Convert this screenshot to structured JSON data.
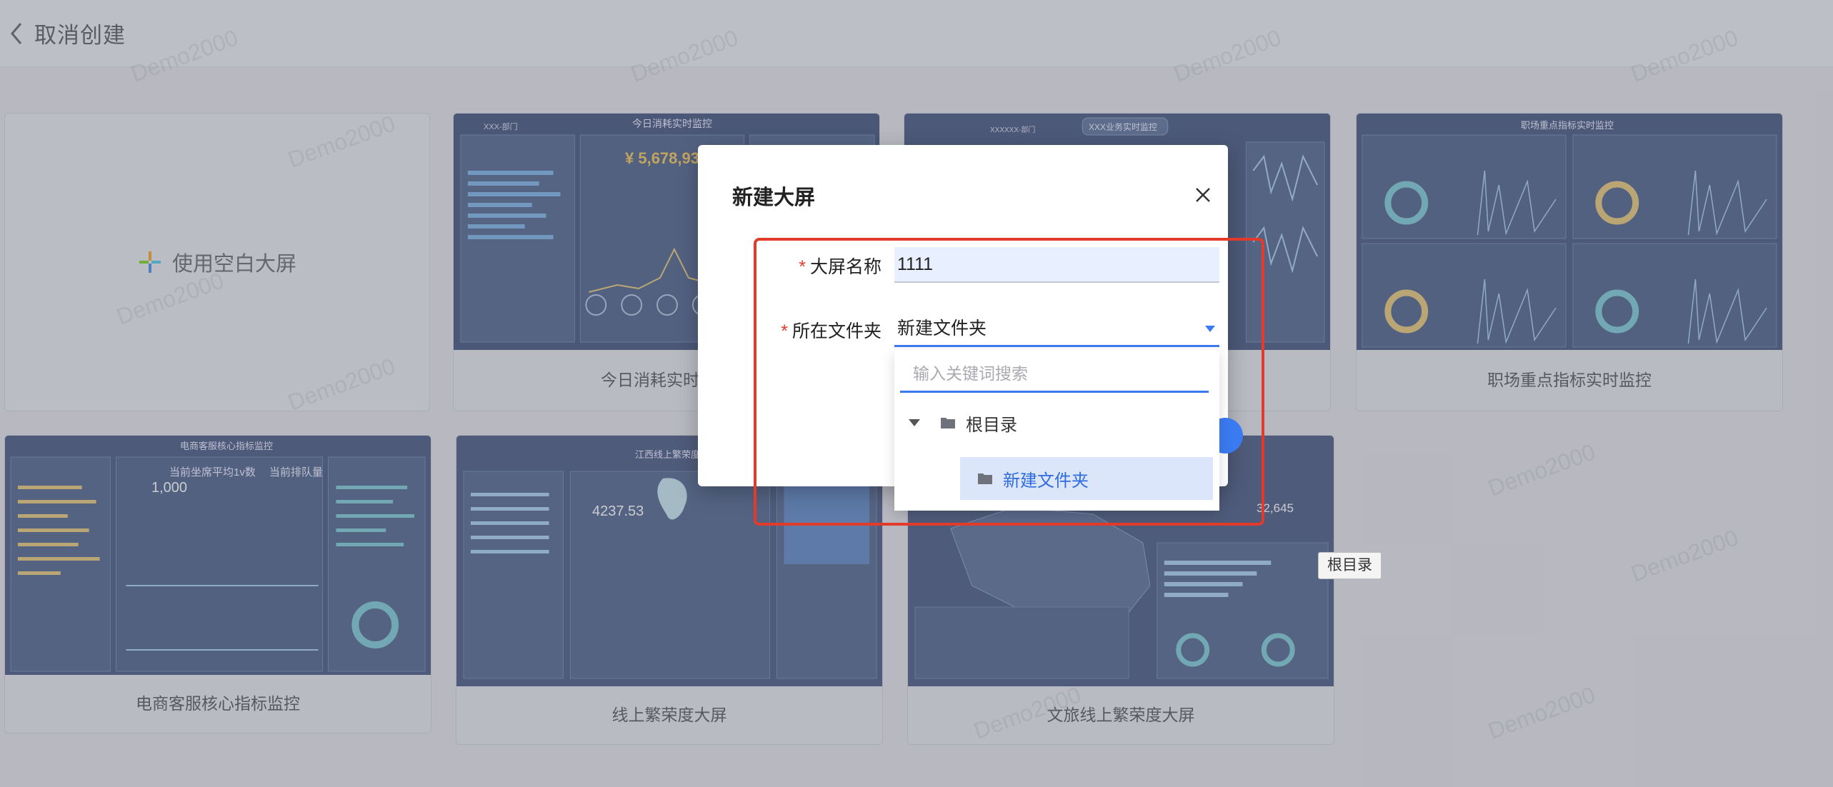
{
  "topbar": {
    "back_icon": "chevron-left-icon",
    "title": "取消创建"
  },
  "blank_card": {
    "label": "使用空白大屏",
    "icon": "plus-icon"
  },
  "templates": [
    {
      "caption": "今日消耗实时监控",
      "thumb_title": "今日消耗实时监控",
      "thumb_dept": "XXX-部门",
      "thumb_value": "¥ 5,678,93"
    },
    {
      "caption": "",
      "thumb_title": "XXX业务实时监控",
      "thumb_dept": "XXXXXX-部门"
    },
    {
      "caption": "职场重点指标实时监控",
      "thumb_title": "职场重点指标实时监控"
    },
    {
      "caption": "电商客服核心指标监控",
      "thumb_title": "电商客服核心指标监控",
      "thumb_line1": "当前坐席平均1v数",
      "thumb_line2": "当前排队量",
      "thumb_num": "1,000"
    },
    {
      "caption": "线上繁荣度大屏",
      "thumb_title": "江西线上繁荣度大",
      "thumb_value": "4237.53"
    },
    {
      "caption": "文旅线上繁荣度大屏",
      "thumb_value": "32,645"
    }
  ],
  "watermark": "Demo2000",
  "modal": {
    "title": "新建大屏",
    "close_icon": "close-icon",
    "name_label": "大屏名称",
    "name_value": "1111",
    "folder_label": "所在文件夹",
    "folder_value": "新建文件夹",
    "search_placeholder": "输入关键词搜索",
    "tree": {
      "root": "根目录",
      "child": "新建文件夹"
    }
  },
  "tooltip": "根目录",
  "colors": {
    "accent": "#3b7bf1",
    "required": "#e23a2b",
    "highlight_box": "#e23a2b"
  }
}
